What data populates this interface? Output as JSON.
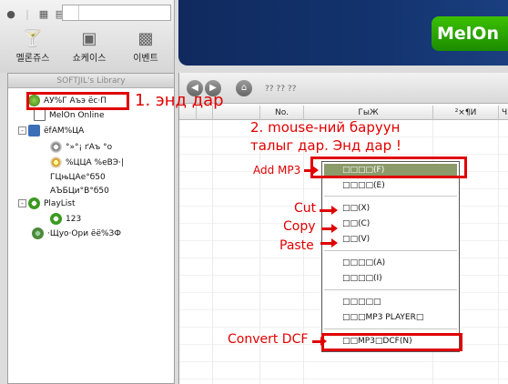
{
  "toolbar": {
    "nav": [
      {
        "label": "멜론쥬스",
        "icon": "cocktail-icon"
      },
      {
        "label": "쇼케이스",
        "icon": "tv-icon"
      },
      {
        "label": "이벤트",
        "icon": "gift-icon"
      }
    ]
  },
  "brand": {
    "logo_text": "MelOn"
  },
  "sidebar": {
    "header": "SOFTJIL's Library",
    "items": [
      {
        "label": "AУ%Г Aъэ ёс·П"
      },
      {
        "label": "MelOn Online"
      },
      {
        "label": "ёfAM%ЦA"
      },
      {
        "label": "°»°¡ ґAъ °о"
      },
      {
        "label": "%ЦЦA %еВЭ·|"
      },
      {
        "label": "ГЦњЦAе°б50"
      },
      {
        "label": "AЪБЦи°В°б50"
      },
      {
        "label": "PlayList"
      },
      {
        "label": "123"
      },
      {
        "label": "·Щуо·Ори ёё%ЗФ"
      }
    ]
  },
  "main": {
    "path": "?? ?? ??",
    "columns": [
      "No.",
      "ГыЖ",
      "²×¶И",
      "Ч"
    ]
  },
  "context_menu": {
    "items": [
      "□□□□(F)",
      "□□□□(E)",
      "□□(X)",
      "□□(C)",
      "□□(V)",
      "□□□□(A)",
      "□□□□(I)",
      "□□□□□",
      "□□□MP3 PLAYER□",
      "□□MP3□DCF(N)"
    ]
  },
  "annotations": {
    "step1": "1. энд дар",
    "step2_line1": "2. mouse-ний баруун",
    "step2_line2": "талыг дар. Энд дар !",
    "add_mp3": "Add MP3",
    "cut": "Cut",
    "copy": "Copy",
    "paste": "Paste",
    "convert_dcf": "Convert DCF"
  },
  "colors": {
    "annotation_red": "#e00000",
    "banner_blue": "#13336e",
    "brand_green": "#2aa800",
    "menu_selection": "#8b9b6a"
  }
}
